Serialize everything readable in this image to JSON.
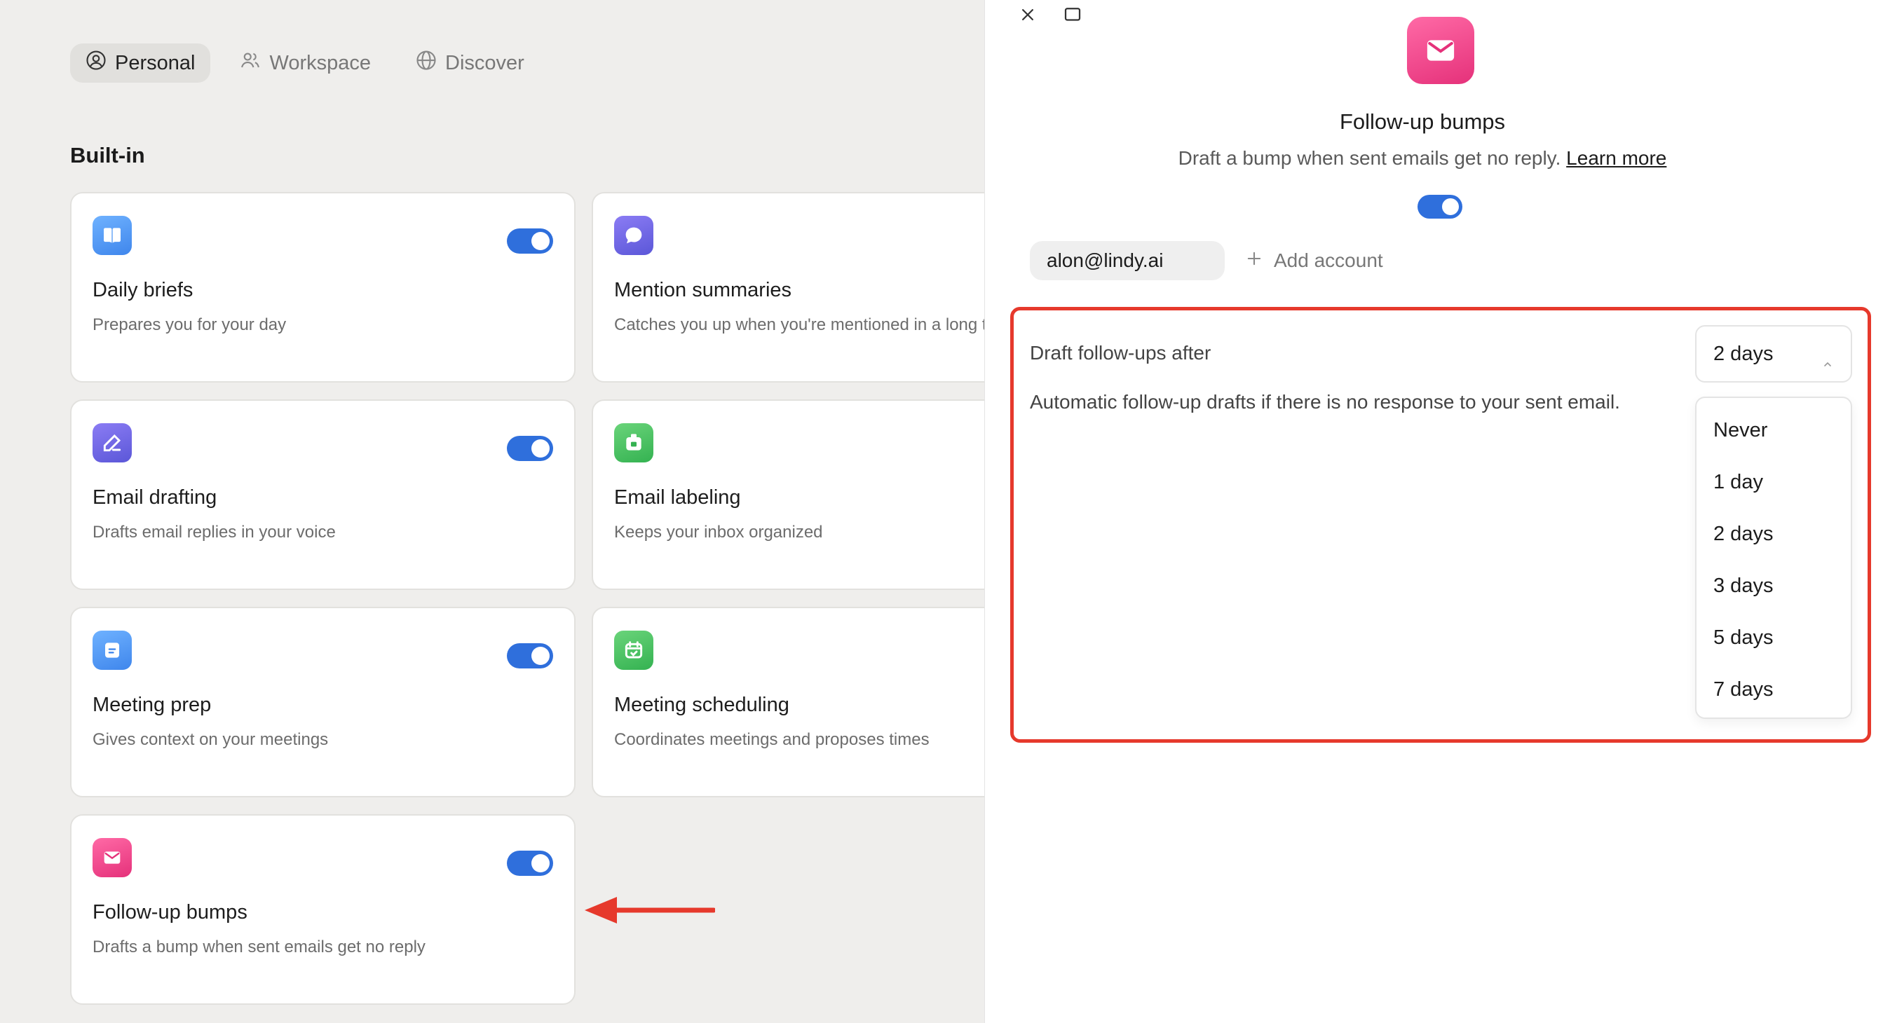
{
  "colors": {
    "accent": "#2f6fdc",
    "highlight": "#e6392c",
    "arrow": "#e6392c"
  },
  "nav": {
    "tabs": [
      {
        "label": "Personal",
        "icon": "person-circle-icon",
        "active": true
      },
      {
        "label": "Workspace",
        "icon": "people-icon",
        "active": false
      },
      {
        "label": "Discover",
        "icon": "globe-icon",
        "active": false
      }
    ]
  },
  "section": {
    "title": "Built-in"
  },
  "cards": [
    {
      "title": "Daily briefs",
      "desc": "Prepares you for your day",
      "icon": "book-icon",
      "toggle": true
    },
    {
      "title": "Mention summaries",
      "desc": "Catches you up when you're mentioned in a long thread.",
      "icon": "chat-bubble-icon",
      "toggle": null
    },
    {
      "title": "Email drafting",
      "desc": "Drafts email replies in your voice",
      "icon": "pen-icon",
      "toggle": true
    },
    {
      "title": "Email labeling",
      "desc": "Keeps your inbox organized",
      "icon": "label-icon",
      "toggle": null
    },
    {
      "title": "Meeting prep",
      "desc": "Gives context on your meetings",
      "icon": "note-icon",
      "toggle": true
    },
    {
      "title": "Meeting scheduling",
      "desc": "Coordinates meetings and proposes times",
      "icon": "calendar-icon",
      "toggle": null
    },
    {
      "title": "Follow-up bumps",
      "desc": "Drafts a bump when sent emails get no reply",
      "icon": "envelope-icon",
      "toggle": true
    }
  ],
  "panel": {
    "title": "Follow-up bumps",
    "subtitle": "Draft a bump when sent emails get no reply.",
    "learn_more": "Learn more",
    "enabled": true,
    "account": "alon@lindy.ai",
    "add_account": "Add account",
    "setting": {
      "label": "Draft follow-ups after",
      "description": "Automatic follow-up drafts if there is no response to your sent email.",
      "selected": "2 days",
      "options": [
        "Never",
        "1 day",
        "2 days",
        "3 days",
        "5 days",
        "7 days"
      ]
    }
  }
}
